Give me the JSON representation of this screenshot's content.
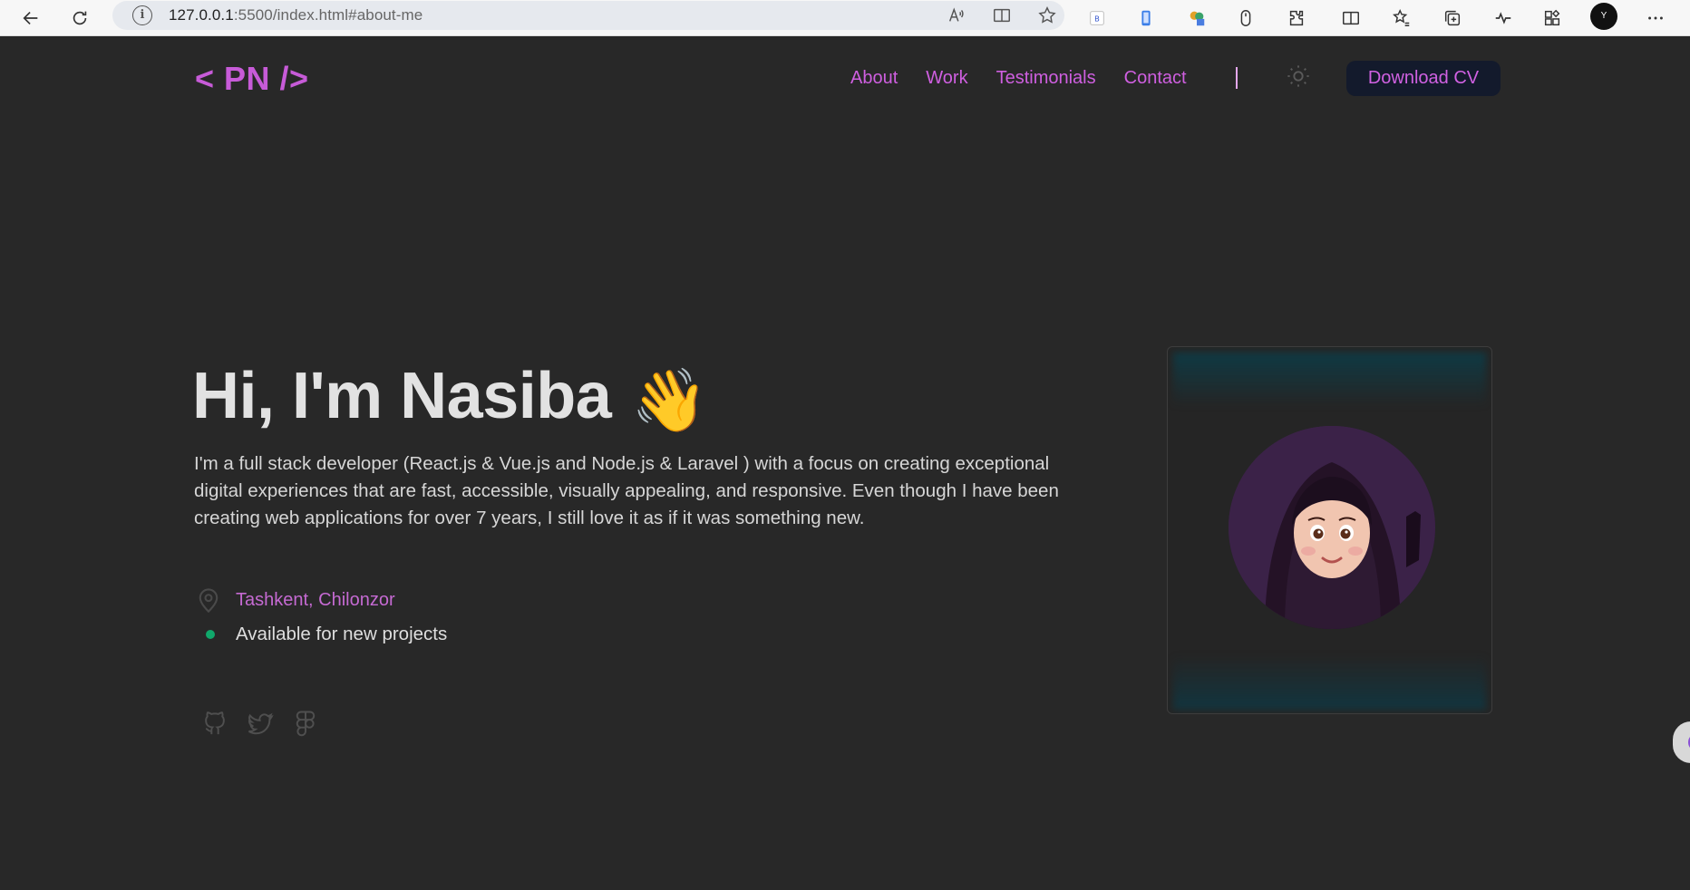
{
  "browser": {
    "url_host": "127.0.0.1",
    "url_path": ":5500/index.html#about-me"
  },
  "header": {
    "logo": "< PN />",
    "nav": [
      {
        "label": "About"
      },
      {
        "label": "Work"
      },
      {
        "label": "Testimonials"
      },
      {
        "label": "Contact"
      }
    ],
    "cta_label": "Download CV"
  },
  "hero": {
    "title": "Hi, I'm Nasiba",
    "emoji": "👋",
    "description": "I'm a full stack developer (React.js & Vue.js and Node.js & Laravel ) with a focus on creating exceptional digital experiences that are fast, accessible, visually appealing, and responsive. Even though I have been creating web applications for over 7 years, I still love it as if it was something new.",
    "location": "Tashkent, Chilonzor",
    "availability": "Available for new projects",
    "socials": [
      {
        "icon": "github-icon"
      },
      {
        "icon": "twitter-icon"
      },
      {
        "icon": "figma-icon"
      }
    ]
  },
  "colors": {
    "accent": "#cf5fe0",
    "background": "#282828",
    "status": "#10a86b"
  }
}
